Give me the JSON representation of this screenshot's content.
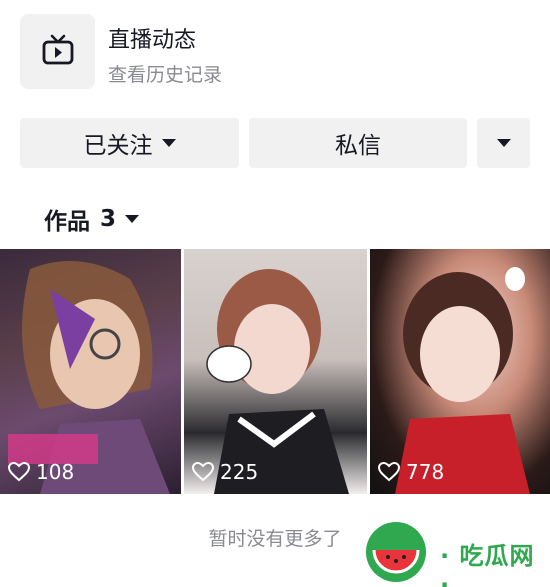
{
  "live": {
    "title": "直播动态",
    "subtitle": "查看历史记录",
    "icon": "tv-icon"
  },
  "actions": {
    "follow_label": "已关注",
    "message_label": "私信"
  },
  "works": {
    "label": "作品",
    "count": "3"
  },
  "videos": [
    {
      "likes": "108"
    },
    {
      "likes": "225"
    },
    {
      "likes": "778"
    }
  ],
  "footer": {
    "no_more": "暂时没有更多了"
  },
  "watermark": {
    "text": "· 吃瓜网 ·"
  },
  "colors": {
    "button_bg": "#f1f1f2",
    "text_primary": "#161823",
    "text_secondary": "#8a8b91",
    "watermark": "#2fa84f"
  }
}
